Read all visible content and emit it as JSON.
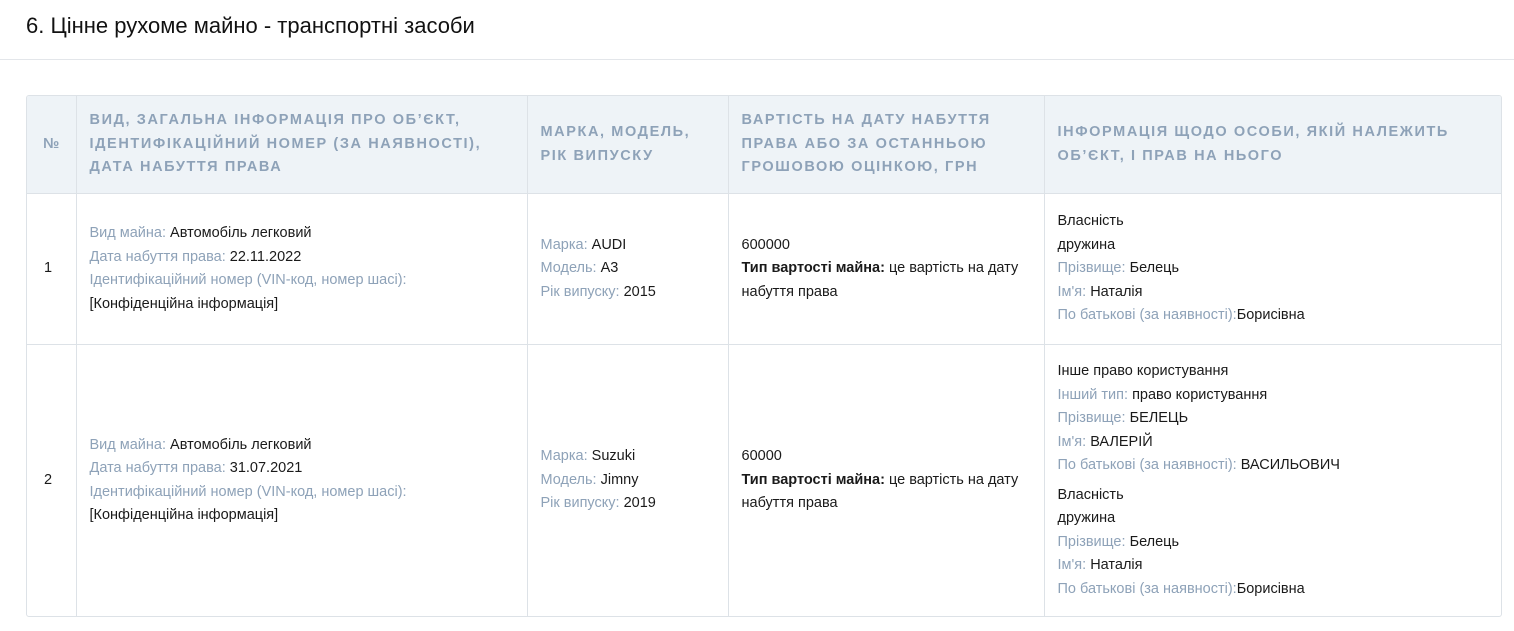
{
  "section": {
    "title": "6. Цінне рухоме майно - транспортні засоби"
  },
  "table": {
    "headers": [
      "№",
      "Вид, загальна інформація про об’єкт, ідентифікаційний номер (за наявності), дата набуття права",
      "Марка, модель, рік випуску",
      "Вартість на дату набуття права або за останньою грошовою оцінкою, грн",
      "Інформація щодо особи, якій належить об’єкт, і прав на нього"
    ],
    "rows": [
      {
        "num": "1",
        "info": {
          "type_label": "Вид майна:",
          "type_value": "Автомобіль легковий",
          "date_label": "Дата набуття права:",
          "date_value": "22.11.2022",
          "id_label": "Ідентифікаційний номер (VIN-код, номер шасі):",
          "id_value": "[Конфіденційна інформація]"
        },
        "vehicle": {
          "brand_label": "Марка:",
          "brand_value": "AUDI",
          "model_label": "Модель:",
          "model_value": "A3",
          "year_label": "Рік випуску:",
          "year_value": "2015"
        },
        "cost": {
          "amount": "600000",
          "type_label": "Тип вартості майна:",
          "type_value": "це вартість на дату набуття права"
        },
        "owners": [
          {
            "right": "Власність",
            "relation": "дружина",
            "surname_label": "Прізвище:",
            "surname": "Белець",
            "name_label": "Ім'я:",
            "name": "Наталія",
            "patronymic_label": "По батькові (за наявності):",
            "patronymic": "Борисівна"
          }
        ]
      },
      {
        "num": "2",
        "info": {
          "type_label": "Вид майна:",
          "type_value": "Автомобіль легковий",
          "date_label": "Дата набуття права:",
          "date_value": "31.07.2021",
          "id_label": "Ідентифікаційний номер (VIN-код, номер шасі):",
          "id_value": "[Конфіденційна інформація]"
        },
        "vehicle": {
          "brand_label": "Марка:",
          "brand_value": "Suzuki",
          "model_label": "Модель:",
          "model_value": "Jimny",
          "year_label": "Рік випуску:",
          "year_value": "2019"
        },
        "cost": {
          "amount": "60000",
          "type_label": "Тип вартості майна:",
          "type_value": "це вартість на дату набуття права"
        },
        "owners": [
          {
            "right": "Інше право користування",
            "other_type_label": "Інший тип:",
            "other_type": "право користування",
            "surname_label": "Прізвище:",
            "surname": "БЕЛЕЦЬ",
            "name_label": "Ім'я:",
            "name": "ВАЛЕРІЙ",
            "patronymic_label": "По батькові (за наявності):",
            "patronymic": "ВАСИЛЬОВИЧ"
          },
          {
            "right": "Власність",
            "relation": "дружина",
            "surname_label": "Прізвище:",
            "surname": "Белець",
            "name_label": "Ім'я:",
            "name": "Наталія",
            "patronymic_label": "По батькові (за наявності):",
            "patronymic": "Борисівна"
          }
        ]
      }
    ]
  }
}
